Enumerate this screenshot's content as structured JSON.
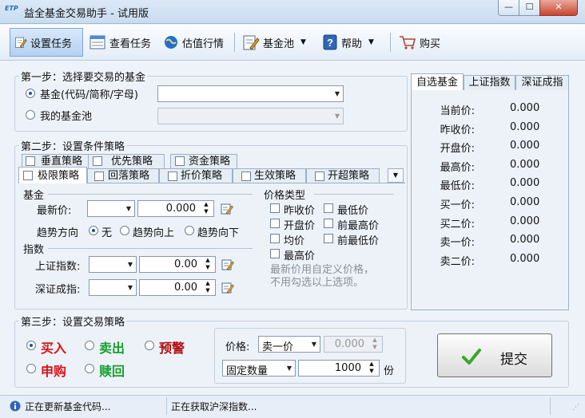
{
  "window": {
    "title": "益全基金交易助手 - 试用版",
    "app_icon_text": "ETP",
    "min": "—",
    "max": "☐",
    "close": "✕"
  },
  "toolbar": {
    "set_task": "设置任务",
    "view_task": "查看任务",
    "valuation": "估值行情",
    "fund_pool": "基金池",
    "help": "帮助",
    "buy": "购买"
  },
  "step1": {
    "title": "第一步：选择要交易的基金",
    "radio_fund": "基金(代码/简称/字母)",
    "radio_pool": "我的基金池",
    "fund_input": "",
    "pool_input": ""
  },
  "step2": {
    "title": "第二步：设置条件策略",
    "tabs_back": [
      "垂直策略",
      "优先策略",
      "资金策略"
    ],
    "tabs_front": [
      "极限策略",
      "回落策略",
      "折价策略",
      "生效策略",
      "开超策略"
    ],
    "fund_label": "基金",
    "latest_price_label": "最新价:",
    "latest_price_value": "0.000",
    "trend_label": "趋势方向",
    "trend_options": [
      "无",
      "趋势向上",
      "趋势向下"
    ],
    "index_label": "指数",
    "sh_label": "上证指数:",
    "sh_value": "0.00",
    "sz_label": "深证成指:",
    "sz_value": "0.00",
    "price_type_label": "价格类型",
    "price_types": [
      "昨收价",
      "最低价",
      "开盘价",
      "前最高价",
      "均价",
      "前最低价",
      "最高价"
    ],
    "note": "最新价用自定义价格，\n不用勾选以上选项。"
  },
  "quotes": {
    "tabs": [
      "自选基金",
      "上证指数",
      "深证成指"
    ],
    "rows": [
      {
        "label": "当前价:",
        "value": "0.000"
      },
      {
        "label": "昨收价:",
        "value": "0.000"
      },
      {
        "label": "开盘价:",
        "value": "0.000"
      },
      {
        "label": "最高价:",
        "value": "0.000"
      },
      {
        "label": "最低价:",
        "value": "0.000"
      },
      {
        "label": "买一价:",
        "value": "0.000"
      },
      {
        "label": "买二价:",
        "value": "0.000"
      },
      {
        "label": "卖一价:",
        "value": "0.000"
      },
      {
        "label": "卖二价:",
        "value": "0.000"
      }
    ]
  },
  "step3": {
    "title": "第三步：设置交易策略",
    "actions": [
      {
        "label": "买入",
        "color": "#d81414"
      },
      {
        "label": "卖出",
        "color": "#15a02c"
      },
      {
        "label": "预警",
        "color": "#b00d0d"
      },
      {
        "label": "申购",
        "color": "#d81414"
      },
      {
        "label": "赎回",
        "color": "#15a02c"
      }
    ],
    "price_label": "价格:",
    "price_select": "卖一价",
    "price_value": "0.000",
    "qty_select": "固定数量",
    "qty_value": "1000",
    "qty_unit": "份",
    "submit": "提交"
  },
  "status": {
    "left": "正在更新基金代码...",
    "right": "正在获取沪深指数..."
  },
  "colors": {
    "accent": "#1c4fa8",
    "check_green": "#39a628"
  }
}
